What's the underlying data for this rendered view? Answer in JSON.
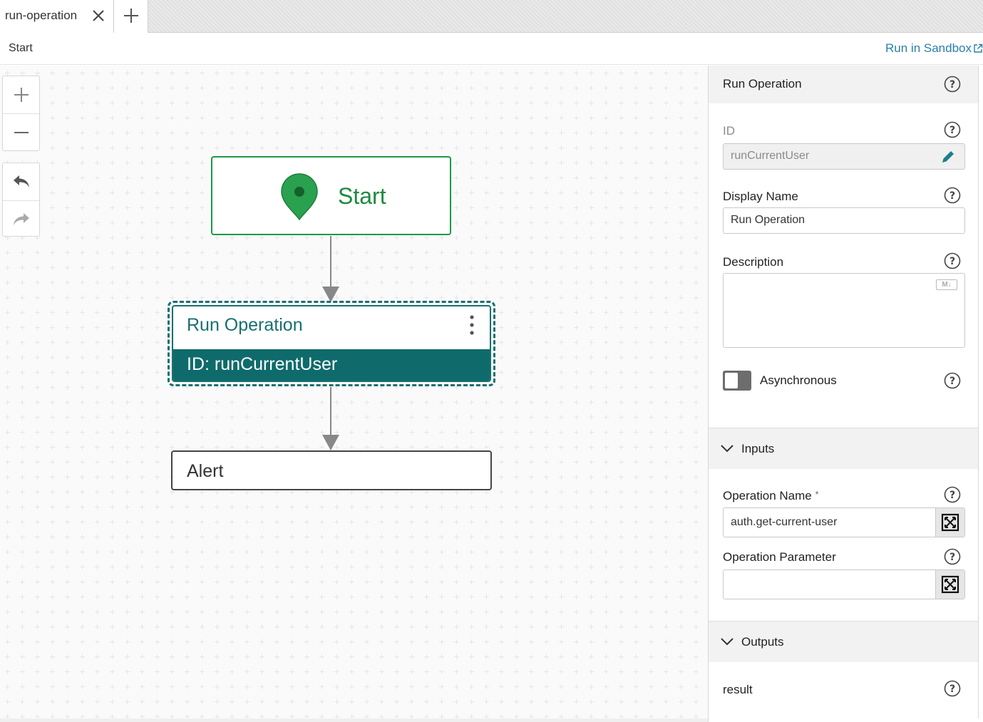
{
  "tabs": [
    {
      "label": "run-operation",
      "active": true
    }
  ],
  "breadcrumb": {
    "current": "Start"
  },
  "header": {
    "sandbox_link": "Run in Sandbox"
  },
  "canvas": {
    "nodes": {
      "start": {
        "label": "Start"
      },
      "run_operation": {
        "title": "Run Operation",
        "id_text": "ID: runCurrentUser"
      },
      "alert": {
        "title": "Alert"
      }
    }
  },
  "panel": {
    "title": "Run Operation",
    "id": {
      "label": "ID",
      "value": "runCurrentUser"
    },
    "display_name": {
      "label": "Display Name",
      "value": "Run Operation"
    },
    "description": {
      "label": "Description",
      "value": "",
      "badge": "M↓"
    },
    "asynchronous": {
      "label": "Asynchronous",
      "enabled": false
    },
    "inputs": {
      "title": "Inputs",
      "operation_name": {
        "label": "Operation Name",
        "required_mark": "*",
        "value": "auth.get-current-user"
      },
      "operation_parameter": {
        "label": "Operation Parameter",
        "value": ""
      }
    },
    "outputs": {
      "title": "Outputs",
      "result": {
        "label": "result"
      }
    }
  },
  "colors": {
    "start_green": "#1b9a47",
    "run_teal": "#0f6b6b",
    "link_blue": "#2a7fa8"
  }
}
